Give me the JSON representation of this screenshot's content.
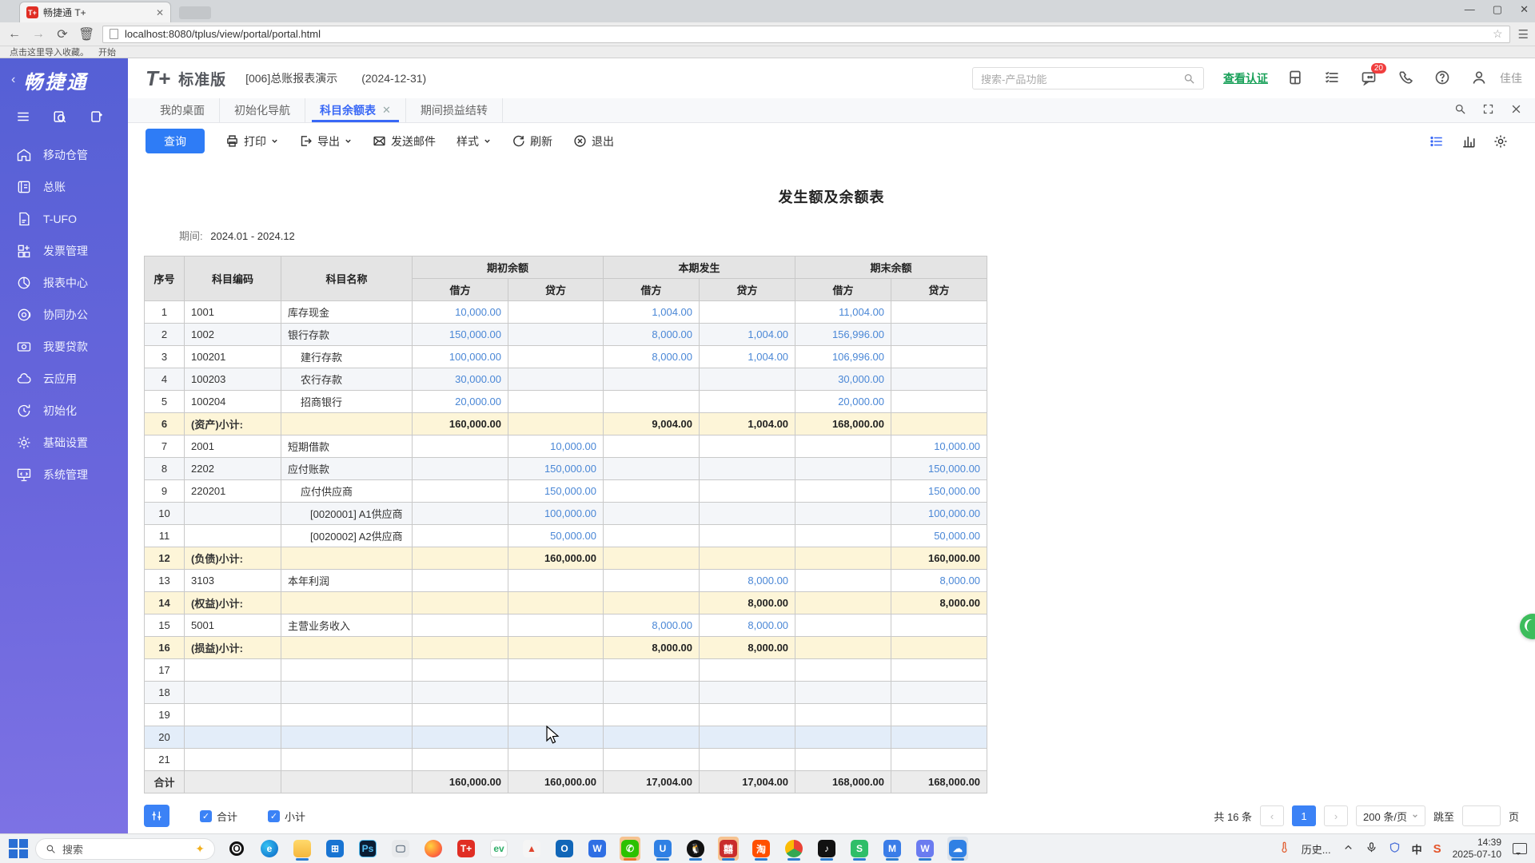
{
  "browser": {
    "tab_title": "畅捷通 T+",
    "tab_favicon": "T+",
    "url": "localhost:8080/tplus/view/portal/portal.html",
    "bookmarks": [
      "点击这里导入收藏。",
      "开始"
    ],
    "window_controls": {
      "minimize": "—",
      "maximize": "▢",
      "close": "✕"
    }
  },
  "app_header": {
    "logo": "T+",
    "edition": "标准版",
    "account": "[006]总账报表演示",
    "date": "(2024-12-31)",
    "search_placeholder": "搜索-产品功能",
    "cert_link": "查看认证",
    "message_badge": "20",
    "username": "佳佳"
  },
  "sidebar": {
    "brand": "畅捷通",
    "items": [
      {
        "icon": "warehouse-icon",
        "label": "移动仓管"
      },
      {
        "icon": "ledger-icon",
        "label": "总账"
      },
      {
        "icon": "ufo-icon",
        "label": "T-UFO"
      },
      {
        "icon": "invoice-icon",
        "label": "发票管理"
      },
      {
        "icon": "report-icon",
        "label": "报表中心"
      },
      {
        "icon": "collab-icon",
        "label": "协同办公"
      },
      {
        "icon": "loan-icon",
        "label": "我要贷款"
      },
      {
        "icon": "cloud-icon",
        "label": "云应用"
      },
      {
        "icon": "init-icon",
        "label": "初始化"
      },
      {
        "icon": "settings-icon",
        "label": "基础设置"
      },
      {
        "icon": "system-icon",
        "label": "系统管理"
      }
    ]
  },
  "doc_tabs": [
    {
      "label": "我的桌面",
      "active": false,
      "closable": false
    },
    {
      "label": "初始化导航",
      "active": false,
      "closable": false
    },
    {
      "label": "科目余额表",
      "active": true,
      "closable": true
    },
    {
      "label": "期间损益结转",
      "active": false,
      "closable": false
    }
  ],
  "toolbar": {
    "query": "查询",
    "print": "打印",
    "export": "导出",
    "send_mail": "发送邮件",
    "style": "样式",
    "refresh": "刷新",
    "exit": "退出"
  },
  "report": {
    "title": "发生额及余额表",
    "period_label": "期间:",
    "period_value": "2024.01 - 2024.12",
    "columns": {
      "seq": "序号",
      "code": "科目编码",
      "name": "科目名称",
      "groups": [
        "期初余额",
        "本期发生",
        "期末余额"
      ],
      "debit": "借方",
      "credit": "贷方"
    },
    "rows": [
      {
        "num": "1",
        "code": "1001",
        "name": "库存现金",
        "indent": 0,
        "values": [
          "10,000.00",
          "",
          "1,004.00",
          "",
          "11,004.00",
          ""
        ],
        "type": "normal"
      },
      {
        "num": "2",
        "code": "1002",
        "name": "银行存款",
        "indent": 0,
        "values": [
          "150,000.00",
          "",
          "8,000.00",
          "1,004.00",
          "156,996.00",
          ""
        ],
        "type": "normal"
      },
      {
        "num": "3",
        "code": "100201",
        "name": "建行存款",
        "indent": 1,
        "values": [
          "100,000.00",
          "",
          "8,000.00",
          "1,004.00",
          "106,996.00",
          ""
        ],
        "type": "normal"
      },
      {
        "num": "4",
        "code": "100203",
        "name": "农行存款",
        "indent": 1,
        "values": [
          "30,000.00",
          "",
          "",
          "",
          "30,000.00",
          ""
        ],
        "type": "normal"
      },
      {
        "num": "5",
        "code": "100204",
        "name": "招商银行",
        "indent": 1,
        "values": [
          "20,000.00",
          "",
          "",
          "",
          "20,000.00",
          ""
        ],
        "type": "normal"
      },
      {
        "num": "6",
        "code": "(资产)小计:",
        "name": "",
        "indent": 0,
        "values": [
          "160,000.00",
          "",
          "9,004.00",
          "1,004.00",
          "168,000.00",
          ""
        ],
        "type": "subtotal"
      },
      {
        "num": "7",
        "code": "2001",
        "name": "短期借款",
        "indent": 0,
        "values": [
          "",
          "10,000.00",
          "",
          "",
          "",
          "10,000.00"
        ],
        "type": "normal"
      },
      {
        "num": "8",
        "code": "2202",
        "name": "应付账款",
        "indent": 0,
        "values": [
          "",
          "150,000.00",
          "",
          "",
          "",
          "150,000.00"
        ],
        "type": "normal"
      },
      {
        "num": "9",
        "code": "220201",
        "name": "应付供应商",
        "indent": 1,
        "values": [
          "",
          "150,000.00",
          "",
          "",
          "",
          "150,000.00"
        ],
        "type": "normal"
      },
      {
        "num": "10",
        "code": "",
        "name": "[0020001] A1供应商",
        "indent": 2,
        "values": [
          "",
          "100,000.00",
          "",
          "",
          "",
          "100,000.00"
        ],
        "type": "normal"
      },
      {
        "num": "11",
        "code": "",
        "name": "[0020002] A2供应商",
        "indent": 2,
        "values": [
          "",
          "50,000.00",
          "",
          "",
          "",
          "50,000.00"
        ],
        "type": "normal"
      },
      {
        "num": "12",
        "code": "(负债)小计:",
        "name": "",
        "indent": 0,
        "values": [
          "",
          "160,000.00",
          "",
          "",
          "",
          "160,000.00"
        ],
        "type": "subtotal"
      },
      {
        "num": "13",
        "code": "3103",
        "name": "本年利润",
        "indent": 0,
        "values": [
          "",
          "",
          "",
          "8,000.00",
          "",
          "8,000.00"
        ],
        "type": "normal"
      },
      {
        "num": "14",
        "code": "(权益)小计:",
        "name": "",
        "indent": 0,
        "values": [
          "",
          "",
          "",
          "8,000.00",
          "",
          "8,000.00"
        ],
        "type": "subtotal"
      },
      {
        "num": "15",
        "code": "5001",
        "name": "主营业务收入",
        "indent": 0,
        "values": [
          "",
          "",
          "8,000.00",
          "8,000.00",
          "",
          ""
        ],
        "type": "normal"
      },
      {
        "num": "16",
        "code": "(损益)小计:",
        "name": "",
        "indent": 0,
        "values": [
          "",
          "",
          "8,000.00",
          "8,000.00",
          "",
          ""
        ],
        "type": "subtotal"
      },
      {
        "num": "17",
        "code": "",
        "name": "",
        "indent": 0,
        "values": [
          "",
          "",
          "",
          "",
          "",
          ""
        ],
        "type": "empty"
      },
      {
        "num": "18",
        "code": "",
        "name": "",
        "indent": 0,
        "values": [
          "",
          "",
          "",
          "",
          "",
          ""
        ],
        "type": "empty"
      },
      {
        "num": "19",
        "code": "",
        "name": "",
        "indent": 0,
        "values": [
          "",
          "",
          "",
          "",
          "",
          ""
        ],
        "type": "empty"
      },
      {
        "num": "20",
        "code": "",
        "name": "",
        "indent": 0,
        "values": [
          "",
          "",
          "",
          "",
          "",
          ""
        ],
        "type": "hover"
      },
      {
        "num": "21",
        "code": "",
        "name": "",
        "indent": 0,
        "values": [
          "",
          "",
          "",
          "",
          "",
          ""
        ],
        "type": "empty"
      }
    ],
    "total": {
      "label": "合计",
      "values": [
        "160,000.00",
        "160,000.00",
        "17,004.00",
        "17,004.00",
        "168,000.00",
        "168,000.00"
      ]
    }
  },
  "report_footer": {
    "total_checkbox": "合计",
    "subtotal_checkbox": "小计",
    "count_text": "共 16 条",
    "prev": "‹",
    "current_page": "1",
    "next": "›",
    "page_size": "200 条/页",
    "jump_label": "跳至",
    "page_unit": "页"
  },
  "taskbar": {
    "search_placeholder": "搜索",
    "apps": [
      {
        "name": "ring-app-icon",
        "glyph": "O",
        "cls": "ring"
      },
      {
        "name": "edge-icon",
        "glyph": "e",
        "cls": "edge"
      },
      {
        "name": "file-explorer-icon",
        "glyph": "",
        "cls": "folder run"
      },
      {
        "name": "ms-store-icon",
        "glyph": "⊞",
        "cls": "store"
      },
      {
        "name": "photoshop-icon",
        "glyph": "Ps",
        "cls": "ps"
      },
      {
        "name": "monitor-app-icon",
        "glyph": "🖵",
        "cls": "mon"
      },
      {
        "name": "firefox-icon",
        "glyph": "🦊",
        "cls": "ff"
      },
      {
        "name": "tplus-icon",
        "glyph": "T+",
        "cls": "tp"
      },
      {
        "name": "ev-icon",
        "glyph": "ev",
        "cls": "ev"
      },
      {
        "name": "capcut-icon",
        "glyph": "▲",
        "cls": "cc"
      },
      {
        "name": "outlook-icon",
        "glyph": "O",
        "cls": "ol"
      },
      {
        "name": "wps-icon",
        "glyph": "W",
        "cls": "wps"
      },
      {
        "name": "wechat-icon",
        "glyph": "✆",
        "cls": "wx hl run orange"
      },
      {
        "name": "u-app-icon",
        "glyph": "U",
        "cls": "uapp run"
      },
      {
        "name": "qq-icon",
        "glyph": "🐧",
        "cls": "qq run"
      },
      {
        "name": "red-app-icon",
        "glyph": "囍",
        "cls": "redapp hl run"
      },
      {
        "name": "taobao-icon",
        "glyph": "淘",
        "cls": "tb run"
      },
      {
        "name": "chrome-icon",
        "glyph": "",
        "cls": "cr run"
      },
      {
        "name": "tiktok-icon",
        "glyph": "♪",
        "cls": "tt run"
      },
      {
        "name": "s-green-icon",
        "glyph": "S",
        "cls": "sg run"
      },
      {
        "name": "m-blue-icon",
        "glyph": "M",
        "cls": "mb run"
      },
      {
        "name": "w-blue-icon",
        "glyph": "W",
        "cls": "wb run"
      },
      {
        "name": "cloud-app-icon",
        "glyph": "☁",
        "cls": "cl hl2 run"
      }
    ],
    "tray_history": "历史...",
    "ime": "中",
    "sogou": "S",
    "time": "14:39",
    "date": "2025-07-10"
  }
}
